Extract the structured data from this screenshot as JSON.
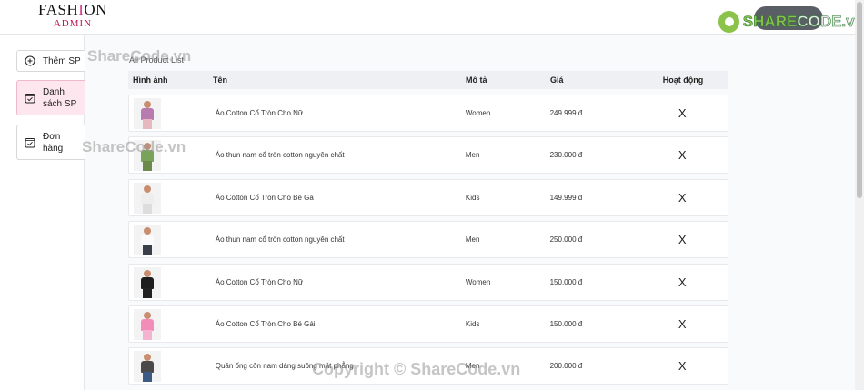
{
  "header": {
    "logo_line1_a": "FASH",
    "logo_line1_b": "I",
    "logo_line1_c": "ON",
    "logo_line2": "ADMIN",
    "brand_a": "SHARE",
    "brand_b": "CODE.vn"
  },
  "sidebar": {
    "items": [
      {
        "label": "Thêm SP",
        "icon": "plus-circle-icon"
      },
      {
        "label": "Danh sách SP",
        "icon": "checklist-icon"
      },
      {
        "label": "Đơn hàng",
        "icon": "checklist-icon"
      }
    ]
  },
  "main": {
    "title": "All Product List",
    "columns": [
      "Hình ảnh",
      "Tên",
      "Mô tả",
      "Giá",
      "Hoạt động"
    ],
    "rows": [
      {
        "name": "Áo Cotton Cổ Tròn Cho Nữ",
        "desc": "Women",
        "price": "249.999 đ",
        "action": "X",
        "body": "#b87bb0",
        "legs": "#e8b8c0"
      },
      {
        "name": "Áo thun nam cổ tròn cotton nguyên chất",
        "desc": "Men",
        "price": "230.000 đ",
        "action": "X",
        "body": "#7aa35a",
        "legs": "#6d8a4c"
      },
      {
        "name": "Áo Cotton Cổ Tròn Cho Bé Gá",
        "desc": "Kids",
        "price": "149.999 đ",
        "action": "X",
        "body": "#eeeeee",
        "legs": "#dddddd"
      },
      {
        "name": "Áo thun nam cổ tròn cotton nguyên chất",
        "desc": "Men",
        "price": "250.000 đ",
        "action": "X",
        "body": "#fafafa",
        "legs": "#3a3f4a"
      },
      {
        "name": "Áo Cotton Cổ Tròn Cho Nữ",
        "desc": "Women",
        "price": "150.000 đ",
        "action": "X",
        "body": "#1d1d1d",
        "legs": "#222222"
      },
      {
        "name": "Áo Cotton Cổ Tròn Cho Bé Gái",
        "desc": "Kids",
        "price": "150.000 đ",
        "action": "X",
        "body": "#f28cb8",
        "legs": "#f5b3cf"
      },
      {
        "name": "Quần ống côn nam dáng suông mặt phẳng",
        "desc": "Men",
        "price": "200.000 đ",
        "action": "X",
        "body": "#4a4a4a",
        "legs": "#3b5b85"
      }
    ]
  },
  "watermarks": {
    "w1": "ShareCode.vn",
    "w2": "ShareCode.vn",
    "w3": "Copyright © ShareCode.vn"
  }
}
